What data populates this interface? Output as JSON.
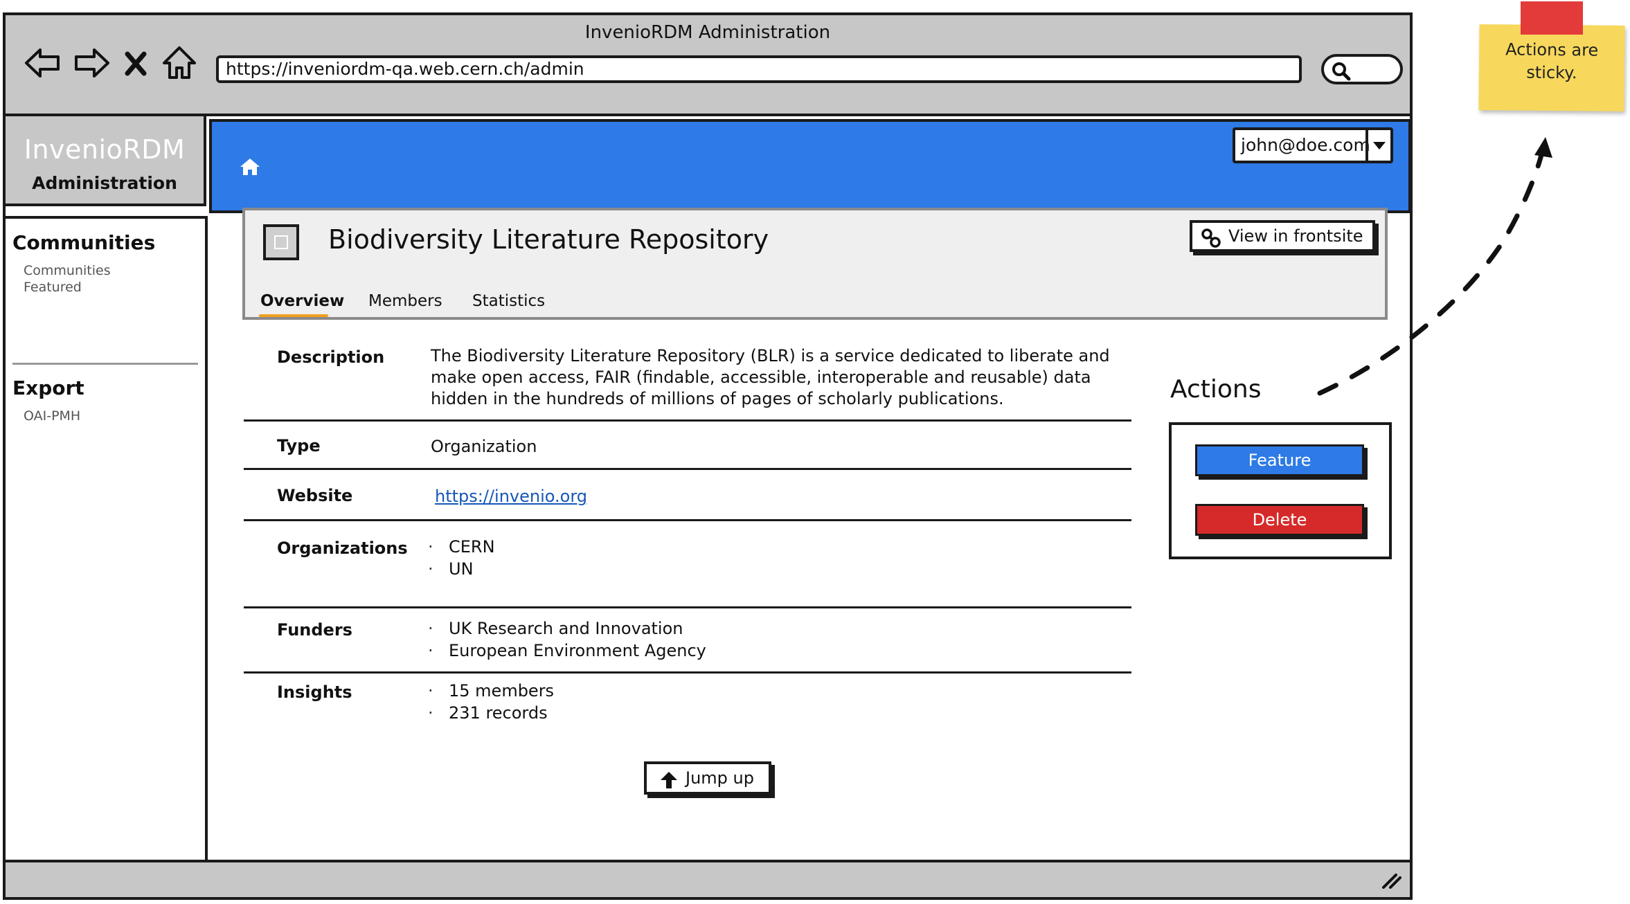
{
  "window": {
    "title": "InvenioRDM Administration",
    "url": "https://inveniordm-qa.web.cern.ch/admin"
  },
  "brand": {
    "name": "InvenioRDM",
    "subtitle": "Administration"
  },
  "header": {
    "user": "john@doe.com"
  },
  "sidebar": {
    "sections": [
      {
        "heading": "Communities",
        "links": [
          "Communities",
          "Featured"
        ]
      },
      {
        "heading": "Export",
        "links": [
          "OAI-PMH"
        ]
      }
    ]
  },
  "community": {
    "title": "Biodiversity Literature Repository",
    "view_button": "View in frontsite",
    "tabs": [
      "Overview",
      "Members",
      "Statistics"
    ],
    "active_tab": "Overview"
  },
  "details": {
    "description_label": "Description",
    "description_lines": [
      "The Biodiversity Literature Repository (BLR) is a service dedicated to liberate and",
      "make open access, FAIR (findable, accessible, interoperable and reusable) data",
      "hidden in the hundreds of millions of pages of scholarly publications."
    ],
    "type_label": "Type",
    "type_value": "Organization",
    "website_label": "Website",
    "website_value": "https://invenio.org",
    "organizations_label": "Organizations",
    "organizations": [
      "CERN",
      "UN"
    ],
    "funders_label": "Funders",
    "funders": [
      "UK Research and Innovation",
      "European Environment Agency"
    ],
    "insights_label": "Insights",
    "insights": [
      "15 members",
      "231 records"
    ]
  },
  "actions": {
    "title": "Actions",
    "feature": "Feature",
    "delete": "Delete",
    "feature_color": "#2e7ae6",
    "delete_color": "#d62a2a"
  },
  "jump_up": "Jump up",
  "sticky_note": {
    "line1": "Actions are",
    "line2": "sticky."
  },
  "colors": {
    "header_blue": "#2e7ae6",
    "chrome_gray": "#c7c7c7",
    "sticky_yellow": "#f7d85c",
    "tape_red": "#e33a3a",
    "tab_underline": "#f0a020"
  }
}
